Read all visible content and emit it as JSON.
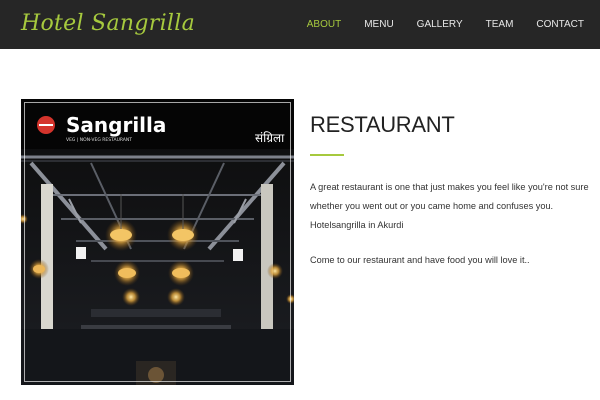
{
  "brand": {
    "name": "Hotel Sangrilla"
  },
  "nav": {
    "items": [
      {
        "label": "ABOUT",
        "active": true
      },
      {
        "label": "MENU",
        "active": false
      },
      {
        "label": "GALLERY",
        "active": false
      },
      {
        "label": "TEAM",
        "active": false
      },
      {
        "label": "CONTACT",
        "active": false
      }
    ]
  },
  "section": {
    "title": "RESTAURANT",
    "paragraph1": "A great restaurant is one that just makes you feel like you're not sure whether you went out or you came home and confuses you. Hotelsangrilla in Akurdi",
    "paragraph2": "Come to our restaurant and have food you will love it.."
  },
  "photo": {
    "sign_text": "Sangrilla",
    "sign_subtext": "VEG | NON-VEG        RESTAURANT",
    "sign_marathi": "संग्रिला"
  },
  "colors": {
    "accent": "#a6c93e",
    "navbar": "#262626"
  }
}
